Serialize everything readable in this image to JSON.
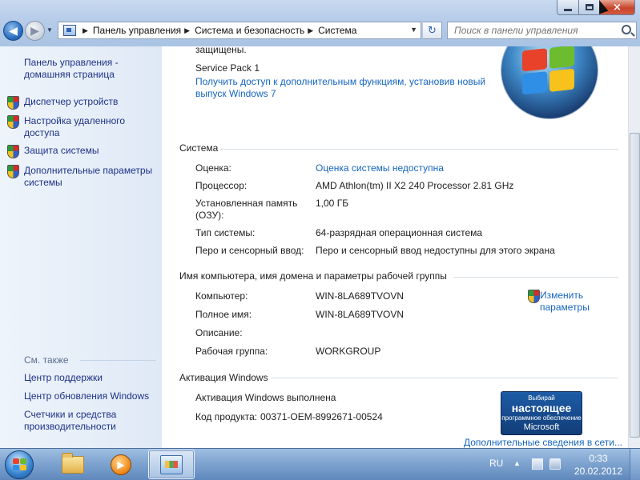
{
  "window": {
    "controls": {
      "minimize": "minimize-icon",
      "maximize": "maximize-icon",
      "close": "×"
    }
  },
  "nav": {
    "back_icon": "◀",
    "forward_icon": "▶",
    "history_icon": "▼",
    "breadcrumb": [
      "Панель управления",
      "Система и безопасность",
      "Система"
    ],
    "refresh_icon": "↻",
    "search_placeholder": "Поиск в панели управления"
  },
  "sidebar": {
    "home": "Панель управления - домашняя страница",
    "items": [
      {
        "label": "Диспетчер устройств"
      },
      {
        "label": "Настройка удаленного доступа"
      },
      {
        "label": "Защита системы"
      },
      {
        "label": "Дополнительные параметры системы"
      }
    ],
    "see_also_title": "См. также",
    "see_also": [
      {
        "label": "Центр поддержки"
      },
      {
        "label": "Центр обновления Windows"
      },
      {
        "label": "Счетчики и средства производительности"
      }
    ]
  },
  "main": {
    "edition_tail": "защищены.",
    "service_pack": "Service Pack 1",
    "upgrade_link": "Получить доступ к дополнительным функциям, установив новый выпуск Windows 7",
    "system": {
      "title": "Система",
      "rows": [
        {
          "label": "Оценка:",
          "value": "Оценка системы недоступна"
        },
        {
          "label": "Процессор:",
          "value": "AMD Athlon(tm) II X2 240 Processor   2.81 GHz"
        },
        {
          "label": "Установленная память (ОЗУ):",
          "value": "1,00 ГБ"
        },
        {
          "label": "Тип системы:",
          "value": "64-разрядная операционная система"
        },
        {
          "label": "Перо и сенсорный ввод:",
          "value": "Перо и сенсорный ввод недоступны для этого экрана"
        }
      ]
    },
    "computer": {
      "title": "Имя компьютера, имя домена и параметры рабочей группы",
      "change_link": "Изменить параметры",
      "rows": [
        {
          "label": "Компьютер:",
          "value": "WIN-8LA689TVOVN"
        },
        {
          "label": "Полное имя:",
          "value": "WIN-8LA689TVOVN"
        },
        {
          "label": "Описание:",
          "value": ""
        },
        {
          "label": "Рабочая группа:",
          "value": "WORKGROUP"
        }
      ]
    },
    "activation": {
      "title": "Активация Windows",
      "status": "Активация Windows выполнена",
      "product_key_label": "Код продукта:",
      "product_key": "00371-OEM-8992671-00524",
      "genuine_badge": {
        "line1": "Выбирай",
        "line2": "настоящее",
        "line3": "программное обеспечение",
        "line4": "Microsoft"
      },
      "more_link": "Дополнительные сведения в сети..."
    }
  },
  "taskbar": {
    "items": [
      {
        "name": "explorer",
        "icon": "folder-icon"
      },
      {
        "name": "media-player",
        "icon": "media-player-icon"
      },
      {
        "name": "control-panel",
        "icon": "control-panel-icon"
      }
    ],
    "language": "RU",
    "tray_arrow": "▲",
    "time": "0:33",
    "date": "20.02.2012"
  },
  "colors": {
    "link": "#1565c0",
    "sidebar_link": "#1e3287",
    "taskbar": "#7fa4d0"
  }
}
